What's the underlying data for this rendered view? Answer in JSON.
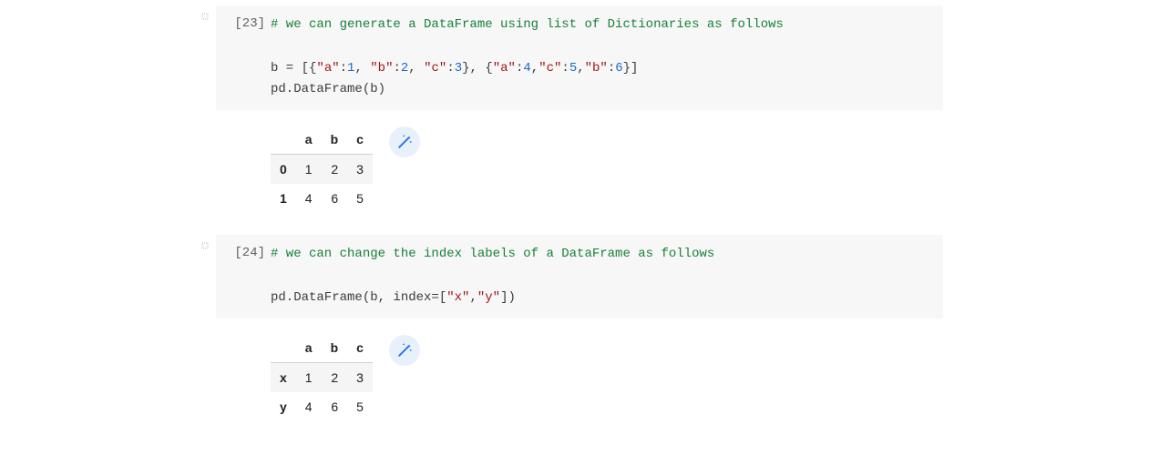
{
  "cells": [
    {
      "exec": "[23]",
      "code": {
        "l1_comment": "# we can generate a DataFrame using list of Dictionaries as follows",
        "l3_pre": "b = [{",
        "l3_k1": "\"a\"",
        "l3_c1": ":",
        "l3_v1": "1",
        "l3_s1": ", ",
        "l3_k2": "\"b\"",
        "l3_c2": ":",
        "l3_v2": "2",
        "l3_s2": ", ",
        "l3_k3": "\"c\"",
        "l3_c3": ":",
        "l3_v3": "3",
        "l3_s3": "}, {",
        "l3_k4": "\"a\"",
        "l3_c4": ":",
        "l3_v4": "4",
        "l3_s4": ",",
        "l3_k5": "\"c\"",
        "l3_c5": ":",
        "l3_v5": "5",
        "l3_s5": ",",
        "l3_k6": "\"b\"",
        "l3_c6": ":",
        "l3_v6": "6",
        "l3_s6": "}]",
        "l4": "pd.DataFrame(b)"
      },
      "output": {
        "columns": [
          "a",
          "b",
          "c"
        ],
        "index": [
          "0",
          "1"
        ],
        "rows": [
          [
            "1",
            "2",
            "3"
          ],
          [
            "4",
            "6",
            "5"
          ]
        ]
      }
    },
    {
      "exec": "[24]",
      "code": {
        "l1_comment": "# we can change the index labels of a DataFrame as follows",
        "l3_pre": "pd.DataFrame(b, index=[",
        "l3_s1": "\"x\"",
        "l3_c1": ",",
        "l3_s2": "\"y\"",
        "l3_c2": "])"
      },
      "output": {
        "columns": [
          "a",
          "b",
          "c"
        ],
        "index": [
          "x",
          "y"
        ],
        "rows": [
          [
            "1",
            "2",
            "3"
          ],
          [
            "4",
            "6",
            "5"
          ]
        ]
      }
    }
  ],
  "icons": {
    "magic": "magic-wand"
  }
}
